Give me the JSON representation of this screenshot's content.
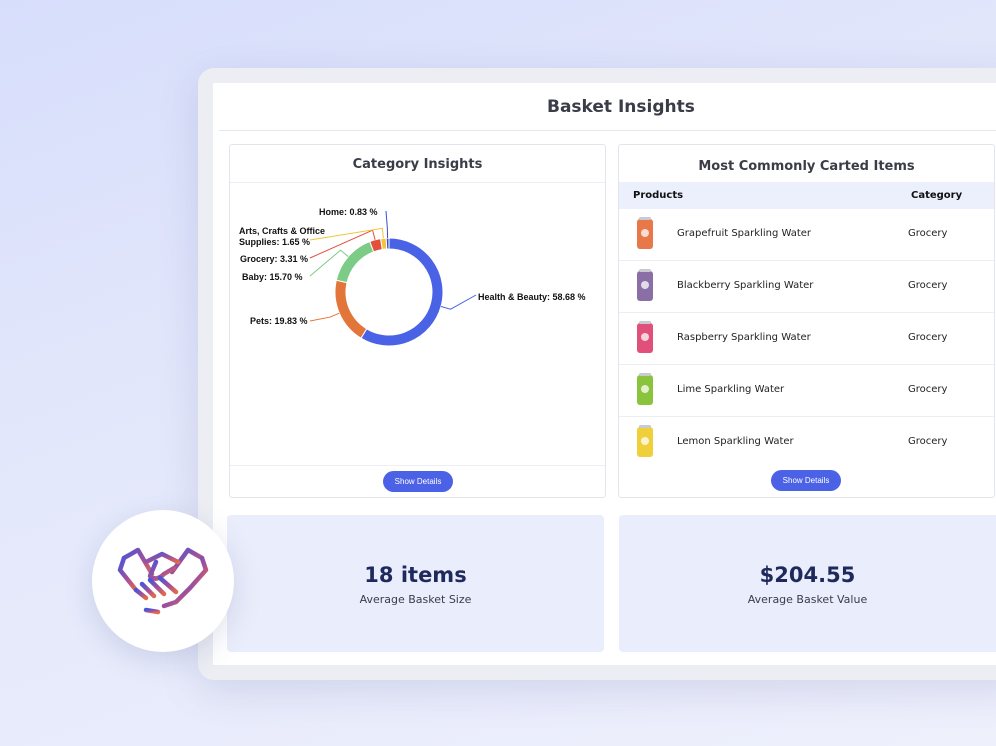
{
  "page": {
    "title": "Basket Insights"
  },
  "category_card": {
    "title": "Category Insights",
    "button_label": "Show Details"
  },
  "chart_data": {
    "type": "pie",
    "donut": true,
    "title": "Category Insights",
    "categories": [
      "Health & Beauty",
      "Pets",
      "Baby",
      "Grocery",
      "Arts, Crafts & Office Supplies",
      "Home"
    ],
    "values": [
      58.68,
      19.83,
      15.7,
      3.31,
      1.65,
      0.83
    ],
    "labels": [
      "Health & Beauty: 58.68 %",
      "Pets: 19.83 %",
      "Baby: 15.70 %",
      "Grocery: 3.31 %",
      "Arts, Crafts & Office",
      "Supplies: 1.65 %",
      "Home: 0.83 %"
    ],
    "colors": [
      "#4a62e6",
      "#e2763a",
      "#7ccb86",
      "#e2503c",
      "#f2c53d",
      "#3a4fd0"
    ]
  },
  "items_card": {
    "title": "Most Commonly Carted Items",
    "columns": [
      "Products",
      "Category"
    ],
    "rows": [
      {
        "product": "Grapefruit Sparkling Water",
        "category": "Grocery",
        "can_color": "#e8784a"
      },
      {
        "product": "Blackberry Sparkling Water",
        "category": "Grocery",
        "can_color": "#8a6fa6"
      },
      {
        "product": "Raspberry Sparkling Water",
        "category": "Grocery",
        "can_color": "#e0507a"
      },
      {
        "product": "Lime Sparkling Water",
        "category": "Grocery",
        "can_color": "#8ac43c"
      },
      {
        "product": "Lemon Sparkling Water",
        "category": "Grocery",
        "can_color": "#efd03a"
      }
    ],
    "button_label": "Show Details"
  },
  "stats": [
    {
      "value": "18 items",
      "label": "Average Basket Size"
    },
    {
      "value": "$204.55",
      "label": "Average Basket Value"
    }
  ],
  "badge": {
    "icon": "handshake-icon"
  }
}
